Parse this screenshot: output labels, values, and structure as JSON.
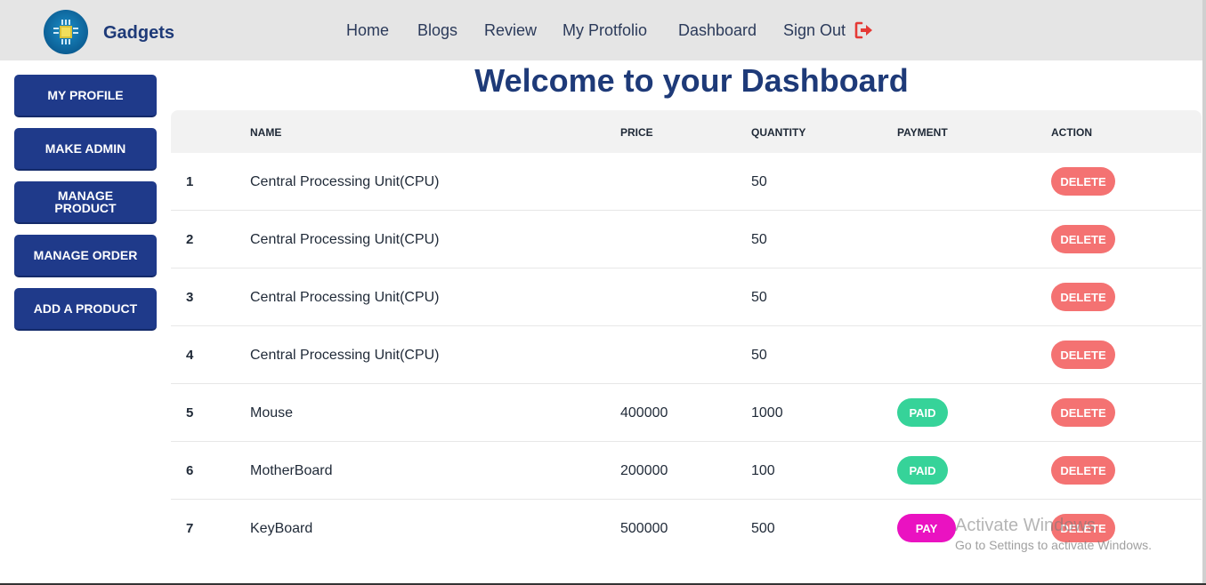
{
  "navbar": {
    "brand": "Gadgets",
    "items": [
      "Home",
      "Blogs",
      "Review",
      "My Protfolio",
      "Dashboard",
      "Sign Out"
    ],
    "signout_icon": "sign-out-icon",
    "signout_icon_color": "#e53935"
  },
  "sidebar": {
    "buttons": [
      "MY PROFILE",
      "MAKE ADMIN",
      "MANAGE PRODUCT",
      "MANAGE ORDER",
      "ADD A PRODUCT"
    ],
    "button_color": "#1f3a8a"
  },
  "main": {
    "title": "Welcome to your Dashboard",
    "table": {
      "headers": [
        "",
        "NAME",
        "PRICE",
        "QUANTITY",
        "PAYMENT",
        "ACTION"
      ],
      "rows": [
        {
          "index": "1",
          "name": "Central Processing Unit(CPU)",
          "price": "",
          "quantity": "50",
          "payment": "",
          "action": "DELETE"
        },
        {
          "index": "2",
          "name": "Central Processing Unit(CPU)",
          "price": "",
          "quantity": "50",
          "payment": "",
          "action": "DELETE"
        },
        {
          "index": "3",
          "name": "Central Processing Unit(CPU)",
          "price": "",
          "quantity": "50",
          "payment": "",
          "action": "DELETE"
        },
        {
          "index": "4",
          "name": "Central Processing Unit(CPU)",
          "price": "",
          "quantity": "50",
          "payment": "",
          "action": "DELETE"
        },
        {
          "index": "5",
          "name": "Mouse",
          "price": "400000",
          "quantity": "1000",
          "payment": "PAID",
          "action": "DELETE"
        },
        {
          "index": "6",
          "name": "MotherBoard",
          "price": "200000",
          "quantity": "100",
          "payment": "PAID",
          "action": "DELETE"
        },
        {
          "index": "7",
          "name": "KeyBoard",
          "price": "500000",
          "quantity": "500",
          "payment": "PAY",
          "action": "DELETE"
        }
      ]
    },
    "colors": {
      "delete": "#f47272",
      "paid": "#36d399",
      "pay": "#ea12c1",
      "title": "#1e3a78"
    }
  },
  "watermark": {
    "line1": "Activate Windows",
    "line2": "Go to Settings to activate Windows."
  }
}
